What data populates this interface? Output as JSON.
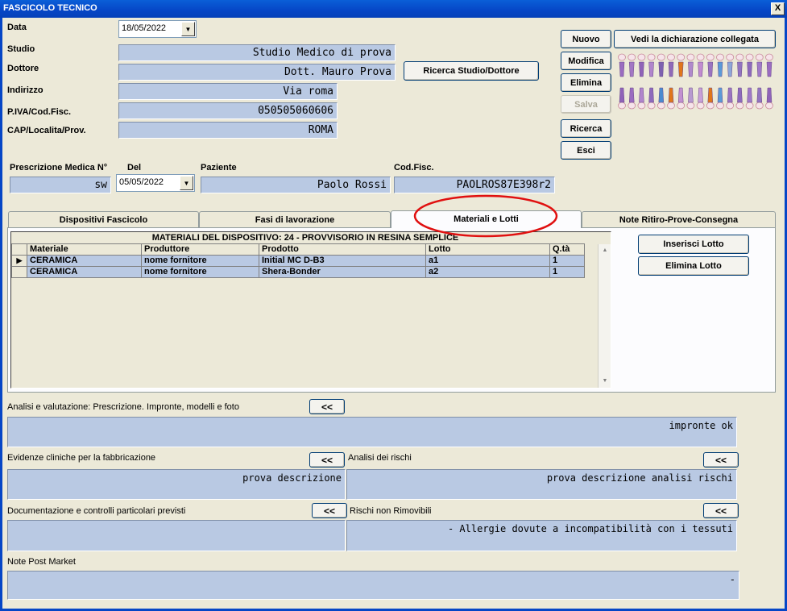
{
  "window": {
    "title": "FASCICOLO TECNICO",
    "close_glyph": "X"
  },
  "header": {
    "data_label": "Data",
    "data_value": "18/05/2022",
    "studio_label": "Studio",
    "studio_value": "Studio Medico di prova",
    "dottore_label": "Dottore",
    "dottore_value": "Dott. Mauro Prova",
    "indirizzo_label": "Indirizzo",
    "indirizzo_value": "Via roma",
    "piva_label": "P.IVA/Cod.Fisc.",
    "piva_value": "050505060606",
    "cap_label": "CAP/Localita/Prov.",
    "cap_value": "ROMA",
    "search_button": "Ricerca Studio/Dottore"
  },
  "actions": {
    "nuovo": "Nuovo",
    "vedi": "Vedi la dichiarazione collegata",
    "modifica": "Modifica",
    "elimina": "Elimina",
    "salva": "Salva",
    "ricerca": "Ricerca",
    "esci": "Esci"
  },
  "prescription": {
    "num_label": "Prescrizione Medica N°",
    "num_value": "sw",
    "del_label": "Del",
    "del_value": "05/05/2022",
    "paziente_label": "Paziente",
    "paziente_value": "Paolo Rossi",
    "codfisc_label": "Cod.Fisc.",
    "codfisc_value": "PAOLROS87E398r2"
  },
  "tabs": [
    {
      "label": "Dispositivi Fascicolo"
    },
    {
      "label": "Fasi di lavorazione"
    },
    {
      "label": "Materiali e Lotti"
    },
    {
      "label": "Note Ritiro-Prove-Consegna"
    }
  ],
  "grid": {
    "caption": "MATERIALI DEL DISPOSITIVO: 24 - PROVVISORIO IN RESINA SEMPLICE",
    "columns": [
      "Materiale",
      "Produttore",
      "Prodotto",
      "Lotto",
      "Q.tà"
    ],
    "rows": [
      [
        "CERAMICA",
        "nome fornitore",
        "Initial MC D-B3",
        "a1",
        "1"
      ],
      [
        "CERAMICA",
        "nome fornitore",
        "Shera-Bonder",
        "a2",
        "1"
      ]
    ],
    "selected_marker": "▶",
    "inserisci": "Inserisci Lotto",
    "elimina": "Elimina Lotto"
  },
  "notes": {
    "analisi_label": "Analisi e valutazione: Prescrizione. Impronte, modelli e foto",
    "analisi_value": "impronte ok",
    "evidenze_label": "Evidenze cliniche per la fabbricazione",
    "evidenze_value": "prova descrizione",
    "rischi_label": "Analisi dei rischi",
    "rischi_value": "prova descrizione analisi rischi",
    "documentazione_label": "Documentazione e controlli particolari previsti",
    "documentazione_value": "",
    "rischi_non_label": "Rischi non Rimovibili",
    "rischi_non_value": "- Allergie dovute a incompatibilità con i tessuti",
    "post_market_label": "Note Post Market",
    "post_market_value": "-",
    "expand_glyph": "<<"
  },
  "colors": {
    "field_bg": "#b9c9e3",
    "window_bg": "#ece9d8",
    "title_blue": "#0646c6",
    "highlight_circle": "#e01010"
  }
}
